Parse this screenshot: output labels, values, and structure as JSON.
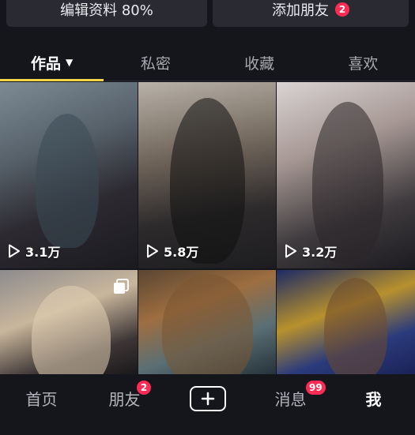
{
  "profile_actions": {
    "edit_label": "编辑资料 80%",
    "add_friend_label": "添加朋友",
    "add_friend_badge": "2"
  },
  "tabs": [
    {
      "label": "作品",
      "active": true
    },
    {
      "label": "私密",
      "active": false
    },
    {
      "label": "收藏",
      "active": false
    },
    {
      "label": "喜欢",
      "active": false
    }
  ],
  "videos": [
    {
      "play_count": "3.1万"
    },
    {
      "play_count": "5.8万"
    },
    {
      "play_count": "3.2万"
    },
    {
      "play_count": ""
    },
    {
      "play_count": ""
    },
    {
      "play_count": ""
    }
  ],
  "bottom_nav": {
    "home": "首页",
    "friends": "朋友",
    "friends_badge": "2",
    "messages": "消息",
    "messages_badge": "99",
    "me": "我"
  },
  "colors": {
    "background": "#15161c",
    "tab_indicator": "#f8d547",
    "badge": "#fe2c55"
  },
  "icons": [
    "play-icon",
    "multi-photo-icon",
    "plus-icon",
    "caret-down-icon"
  ]
}
